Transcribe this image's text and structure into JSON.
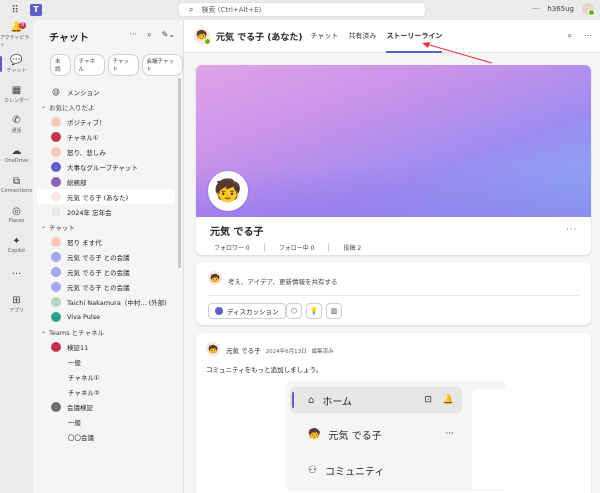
{
  "titlebar": {
    "search_placeholder": "検索 (Ctrl+Alt+E)",
    "more": "···",
    "tenant": "h365ug"
  },
  "rail": [
    {
      "label": "アクティビティ",
      "icon": "bell-icon",
      "badge": "8"
    },
    {
      "label": "チャット",
      "icon": "chat-icon",
      "active": true
    },
    {
      "label": "カレンダー",
      "icon": "calendar-icon"
    },
    {
      "label": "通話",
      "icon": "phone-icon"
    },
    {
      "label": "OneDrive",
      "icon": "cloud-icon"
    },
    {
      "label": "Connections",
      "icon": "connections-icon"
    },
    {
      "label": "Places",
      "icon": "places-icon"
    },
    {
      "label": "Copilot",
      "icon": "copilot-icon"
    },
    {
      "label": "···",
      "icon": "more-icon"
    },
    {
      "label": "アプリ",
      "icon": "add-apps-icon"
    }
  ],
  "pane": {
    "title": "チャット",
    "more": "···",
    "filters": [
      "未読",
      "チャネル",
      "チャット",
      "会議チャット"
    ],
    "mentions": "メンション",
    "favorites_header": "お気に入りだよ",
    "favorites": [
      {
        "name": "ポジティブ！",
        "color": "#f7c8b8"
      },
      {
        "name": "チャネル①",
        "color": "#c4314b"
      },
      {
        "name": "怒り、悲しみ",
        "color": "#f7c8b8"
      },
      {
        "name": "大事なグループチャット",
        "color": "#5b5fc7"
      },
      {
        "name": "総務部",
        "color": "#8764b8"
      },
      {
        "name": "元気 でる子 (あなた)",
        "color": "#fde6e0"
      },
      {
        "name": "2024年 忘年会",
        "color": "#e8e8e8"
      }
    ],
    "chat_header": "チャット",
    "chats": [
      {
        "name": "怒り ます代",
        "color": "#f7c8b8"
      },
      {
        "name": "元気 でる子 との会議",
        "color": "#a4a7e8"
      },
      {
        "name": "元気 でる子 との会議",
        "color": "#a4a7e8"
      },
      {
        "name": "元気 でる子 との会議",
        "color": "#a4a7e8"
      },
      {
        "name": "Taichi Nakamura（中村... (外部)",
        "color": "#b4d7c4"
      },
      {
        "name": "Viva Pulse",
        "color": "#2f9e8f"
      }
    ],
    "teams_header": "Teams とチャネル",
    "teams": [
      {
        "name": "検証11",
        "color": "#c4314b",
        "channels": [
          "一般",
          "チャネル①",
          "チャネル②"
        ]
      },
      {
        "name": "会議検証",
        "color": "#6e6e6e",
        "channels": [
          "一般",
          "〇〇会議"
        ]
      }
    ]
  },
  "main": {
    "name": "元気 でる子 (あなた)",
    "tabs": [
      "チャット",
      "共有済み",
      "ストーリーライン"
    ],
    "profile": {
      "name": "元気 でる子",
      "followers": "フォロワー 0",
      "following": "フォロー中 0",
      "posts": "投稿 2"
    },
    "composer": {
      "prompt": "考え、アイデア、更新情報を共有する",
      "discussion": "ディスカッション"
    },
    "post": {
      "author": "元気 でる子",
      "date": "2024年6月13日",
      "edited": "編集済み",
      "text": "コミュニティをもっと追加しましょう。",
      "shot_items": [
        "ホーム",
        "元気 でる子",
        "コミュニティ"
      ]
    }
  },
  "colors": {
    "accent": "#5b5fc7",
    "annotation_arrow": "#e8343c"
  }
}
